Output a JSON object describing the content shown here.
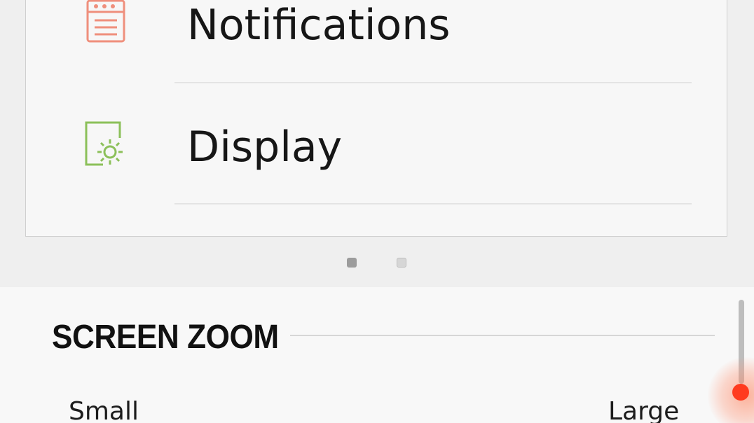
{
  "preview": {
    "items": [
      {
        "label": "Notifications",
        "icon": "notifications-icon",
        "icon_color": "#ef8f7c"
      },
      {
        "label": "Display",
        "icon": "display-icon",
        "icon_color": "#8cc05a"
      }
    ],
    "pager": {
      "pages": 2,
      "current": 1
    }
  },
  "screen_zoom": {
    "title": "SCREEN ZOOM",
    "min_label": "Small",
    "max_label": "Large"
  },
  "colors": {
    "touch_indicator": "#ff3b1f",
    "background": "#efefef",
    "card": "#f7f7f7"
  }
}
